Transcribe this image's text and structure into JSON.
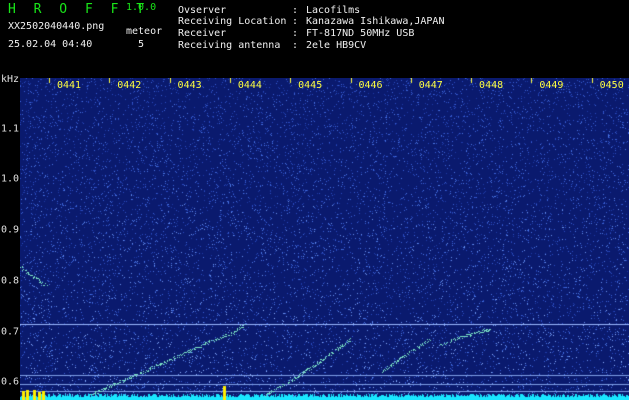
{
  "header": {
    "app_title": "H R O F F T",
    "version": "1.0.0",
    "file_name": "XX2502040440.png",
    "date_time": "25.02.04 04:40",
    "meteor_label": "meteor",
    "meteor_count": "5"
  },
  "info": [
    {
      "label": "Ovserver",
      "value": "Lacofilms"
    },
    {
      "label": "Receiving Location",
      "value": "Kanazawa Ishikawa,JAPAN"
    },
    {
      "label": "Receiver",
      "value": "FT-817ND 50MHz USB"
    },
    {
      "label": "Receiving antenna",
      "value": "2ele HB9CV"
    }
  ],
  "separator": ":",
  "spectrogram": {
    "y_unit": "kHz",
    "y_ticks": [
      "1.1",
      "1.0",
      "0.9",
      "0.8",
      "0.7",
      "0.6"
    ],
    "y_tick_values": [
      1.1,
      1.0,
      0.9,
      0.8,
      0.7,
      0.6
    ],
    "time_ticks": [
      "0441",
      "0442",
      "0443",
      "0444",
      "0445",
      "0446",
      "0447",
      "0448",
      "0449",
      "0450"
    ],
    "freq_range_khz": [
      0.565,
      1.2
    ],
    "time_range": [
      "0440",
      "0450"
    ],
    "horizontal_lines_khz": [
      0.715,
      0.615,
      0.597,
      0.582
    ],
    "colors": {
      "background": "#0a1a6e",
      "noise": "#4a78e6",
      "trace": "#7de6c8",
      "floor": "#19e6ff",
      "tick_text": "#ffff40",
      "burst": "#ffee00"
    }
  }
}
